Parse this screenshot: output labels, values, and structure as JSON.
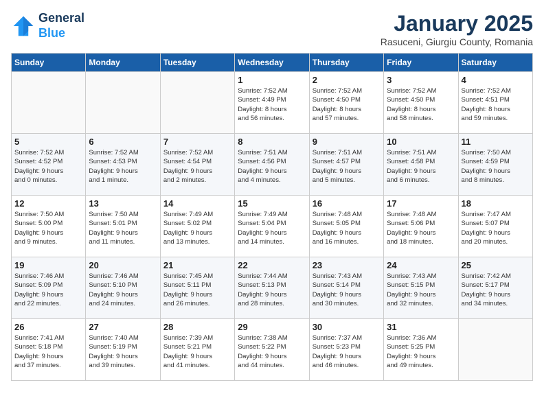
{
  "header": {
    "logo_line1": "General",
    "logo_line2": "Blue",
    "title": "January 2025",
    "subtitle": "Rasuceni, Giurgiu County, Romania"
  },
  "weekdays": [
    "Sunday",
    "Monday",
    "Tuesday",
    "Wednesday",
    "Thursday",
    "Friday",
    "Saturday"
  ],
  "weeks": [
    [
      {
        "day": "",
        "info": ""
      },
      {
        "day": "",
        "info": ""
      },
      {
        "day": "",
        "info": ""
      },
      {
        "day": "1",
        "info": "Sunrise: 7:52 AM\nSunset: 4:49 PM\nDaylight: 8 hours\nand 56 minutes."
      },
      {
        "day": "2",
        "info": "Sunrise: 7:52 AM\nSunset: 4:50 PM\nDaylight: 8 hours\nand 57 minutes."
      },
      {
        "day": "3",
        "info": "Sunrise: 7:52 AM\nSunset: 4:50 PM\nDaylight: 8 hours\nand 58 minutes."
      },
      {
        "day": "4",
        "info": "Sunrise: 7:52 AM\nSunset: 4:51 PM\nDaylight: 8 hours\nand 59 minutes."
      }
    ],
    [
      {
        "day": "5",
        "info": "Sunrise: 7:52 AM\nSunset: 4:52 PM\nDaylight: 9 hours\nand 0 minutes."
      },
      {
        "day": "6",
        "info": "Sunrise: 7:52 AM\nSunset: 4:53 PM\nDaylight: 9 hours\nand 1 minute."
      },
      {
        "day": "7",
        "info": "Sunrise: 7:52 AM\nSunset: 4:54 PM\nDaylight: 9 hours\nand 2 minutes."
      },
      {
        "day": "8",
        "info": "Sunrise: 7:51 AM\nSunset: 4:56 PM\nDaylight: 9 hours\nand 4 minutes."
      },
      {
        "day": "9",
        "info": "Sunrise: 7:51 AM\nSunset: 4:57 PM\nDaylight: 9 hours\nand 5 minutes."
      },
      {
        "day": "10",
        "info": "Sunrise: 7:51 AM\nSunset: 4:58 PM\nDaylight: 9 hours\nand 6 minutes."
      },
      {
        "day": "11",
        "info": "Sunrise: 7:50 AM\nSunset: 4:59 PM\nDaylight: 9 hours\nand 8 minutes."
      }
    ],
    [
      {
        "day": "12",
        "info": "Sunrise: 7:50 AM\nSunset: 5:00 PM\nDaylight: 9 hours\nand 9 minutes."
      },
      {
        "day": "13",
        "info": "Sunrise: 7:50 AM\nSunset: 5:01 PM\nDaylight: 9 hours\nand 11 minutes."
      },
      {
        "day": "14",
        "info": "Sunrise: 7:49 AM\nSunset: 5:02 PM\nDaylight: 9 hours\nand 13 minutes."
      },
      {
        "day": "15",
        "info": "Sunrise: 7:49 AM\nSunset: 5:04 PM\nDaylight: 9 hours\nand 14 minutes."
      },
      {
        "day": "16",
        "info": "Sunrise: 7:48 AM\nSunset: 5:05 PM\nDaylight: 9 hours\nand 16 minutes."
      },
      {
        "day": "17",
        "info": "Sunrise: 7:48 AM\nSunset: 5:06 PM\nDaylight: 9 hours\nand 18 minutes."
      },
      {
        "day": "18",
        "info": "Sunrise: 7:47 AM\nSunset: 5:07 PM\nDaylight: 9 hours\nand 20 minutes."
      }
    ],
    [
      {
        "day": "19",
        "info": "Sunrise: 7:46 AM\nSunset: 5:09 PM\nDaylight: 9 hours\nand 22 minutes."
      },
      {
        "day": "20",
        "info": "Sunrise: 7:46 AM\nSunset: 5:10 PM\nDaylight: 9 hours\nand 24 minutes."
      },
      {
        "day": "21",
        "info": "Sunrise: 7:45 AM\nSunset: 5:11 PM\nDaylight: 9 hours\nand 26 minutes."
      },
      {
        "day": "22",
        "info": "Sunrise: 7:44 AM\nSunset: 5:13 PM\nDaylight: 9 hours\nand 28 minutes."
      },
      {
        "day": "23",
        "info": "Sunrise: 7:43 AM\nSunset: 5:14 PM\nDaylight: 9 hours\nand 30 minutes."
      },
      {
        "day": "24",
        "info": "Sunrise: 7:43 AM\nSunset: 5:15 PM\nDaylight: 9 hours\nand 32 minutes."
      },
      {
        "day": "25",
        "info": "Sunrise: 7:42 AM\nSunset: 5:17 PM\nDaylight: 9 hours\nand 34 minutes."
      }
    ],
    [
      {
        "day": "26",
        "info": "Sunrise: 7:41 AM\nSunset: 5:18 PM\nDaylight: 9 hours\nand 37 minutes."
      },
      {
        "day": "27",
        "info": "Sunrise: 7:40 AM\nSunset: 5:19 PM\nDaylight: 9 hours\nand 39 minutes."
      },
      {
        "day": "28",
        "info": "Sunrise: 7:39 AM\nSunset: 5:21 PM\nDaylight: 9 hours\nand 41 minutes."
      },
      {
        "day": "29",
        "info": "Sunrise: 7:38 AM\nSunset: 5:22 PM\nDaylight: 9 hours\nand 44 minutes."
      },
      {
        "day": "30",
        "info": "Sunrise: 7:37 AM\nSunset: 5:23 PM\nDaylight: 9 hours\nand 46 minutes."
      },
      {
        "day": "31",
        "info": "Sunrise: 7:36 AM\nSunset: 5:25 PM\nDaylight: 9 hours\nand 49 minutes."
      },
      {
        "day": "",
        "info": ""
      }
    ]
  ]
}
